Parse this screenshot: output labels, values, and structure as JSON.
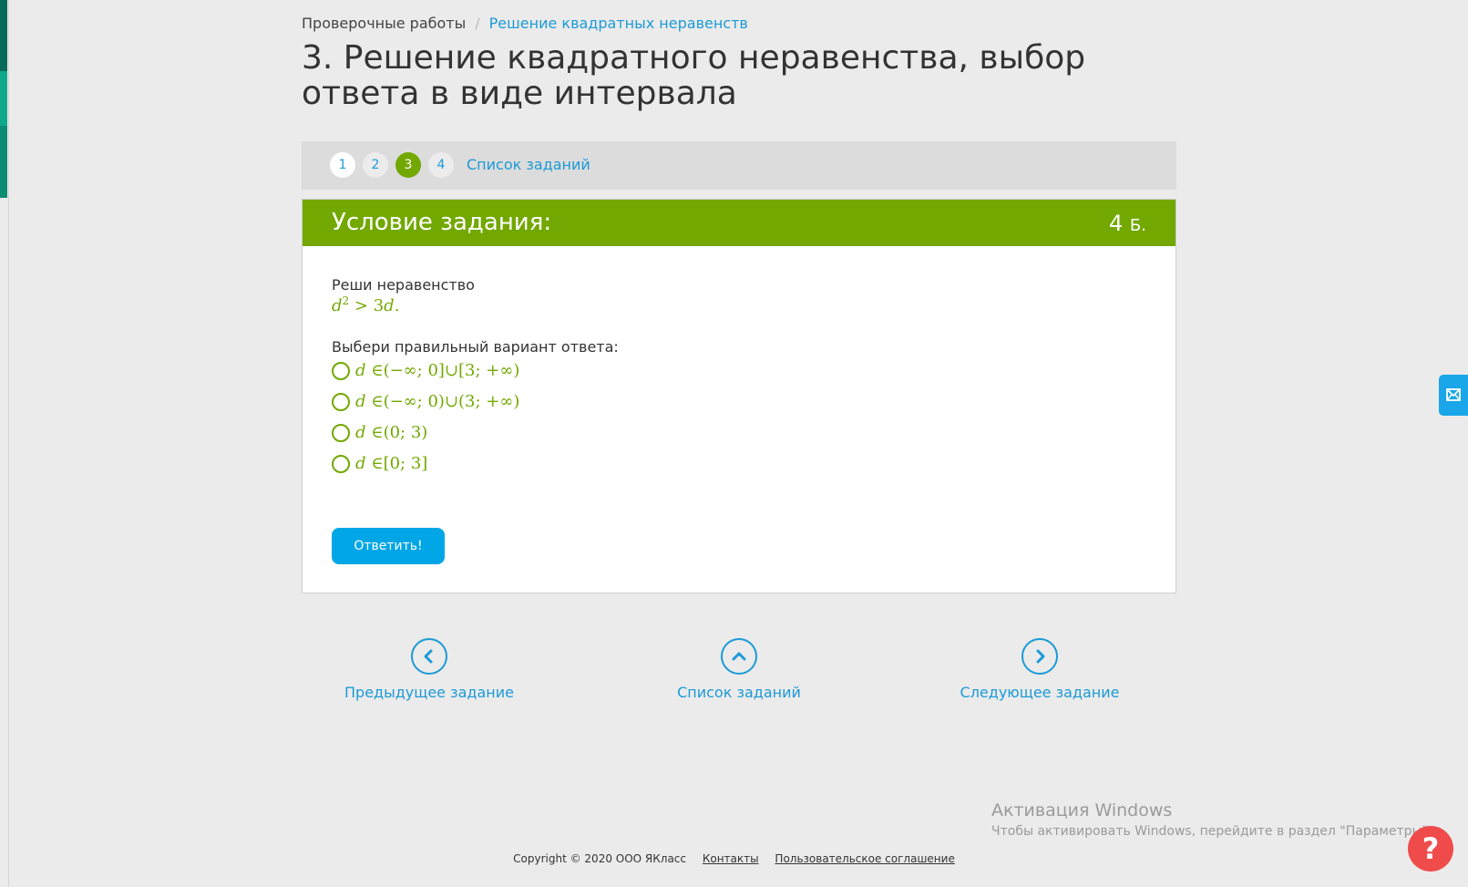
{
  "breadcrumb": {
    "parent": "Проверочные работы",
    "separator": "/",
    "current": "Решение квадратных неравенств"
  },
  "page_title": "3. Решение квадратного неравенства, выбор ответа в виде интервала",
  "pager": {
    "numbers": [
      "1",
      "2",
      "3",
      "4"
    ],
    "active_index": 2,
    "list_link": "Список заданий"
  },
  "task": {
    "header": "Условие задания:",
    "points_value": "4",
    "points_unit": "Б.",
    "prompt": "Реши неравенство",
    "inequality": {
      "var": "d",
      "exp": "2",
      "rest": " > 3",
      "var2": "d",
      "end": "."
    },
    "choose_prompt": "Выбери правильный вариант ответа:",
    "options": [
      {
        "var": "d",
        "text": " ∈(−∞; 0]∪[3; +∞)"
      },
      {
        "var": "d",
        "text": " ∈(−∞; 0)∪(3; +∞)"
      },
      {
        "var": "d",
        "text": " ∈(0; 3)"
      },
      {
        "var": "d",
        "text": " ∈[0; 3]"
      }
    ],
    "submit_label": "Ответить!"
  },
  "bottom_nav": {
    "prev": "Предыдущее задание",
    "list": "Список заданий",
    "next": "Следующее задание"
  },
  "windows_activation": {
    "title": "Активация Windows",
    "subtitle": "Чтобы активировать Windows, перейдите в раздел \"Параметры\"."
  },
  "footer": {
    "copyright": "Copyright © 2020 ООО ЯКласс",
    "contacts": "Контакты",
    "agreement": "Пользовательское соглашение"
  },
  "help_button": "?",
  "colors": {
    "accent_green": "#72a800",
    "link_blue": "#1b9ad6",
    "button_blue": "#00a6e6",
    "help_red": "#ef4b4b"
  },
  "icons": [
    "chevron-left-icon",
    "chevron-up-icon",
    "chevron-right-icon",
    "mail-icon",
    "question-icon"
  ]
}
